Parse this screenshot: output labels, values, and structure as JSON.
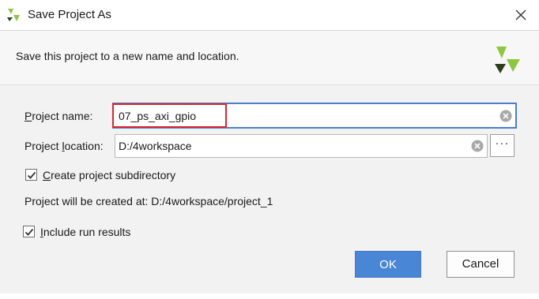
{
  "window": {
    "title": "Save Project As",
    "icon": "vivado-logo-icon",
    "close_icon": "close-icon"
  },
  "header": {
    "description": "Save this project to a new name and location.",
    "brand_icon": "vivado-logo-icon"
  },
  "form": {
    "project_name": {
      "label_mnemonic": "P",
      "label_rest": "roject name:",
      "value": "07_ps_axi_gpio"
    },
    "project_location": {
      "label_before": "Project ",
      "label_mnemonic": "l",
      "label_after": "ocation:",
      "value": "D:/4workspace",
      "browse_label": "···"
    },
    "create_subdir": {
      "label_mnemonic": "C",
      "label_rest": "reate project subdirectory",
      "checked": true
    },
    "created_at": "Project will be created at: D:/4workspace/project_1",
    "include_run_results": {
      "label_mnemonic": "I",
      "label_rest": "nclude run results",
      "checked": true
    }
  },
  "buttons": {
    "ok_label": "OK",
    "cancel_label": "Cancel"
  },
  "colors": {
    "accent": "#4a86d6",
    "highlight": "#e0242b",
    "focus_border": "#4a7ed1",
    "logo_green": "#8dc63f",
    "logo_dark": "#2f3e1a"
  }
}
